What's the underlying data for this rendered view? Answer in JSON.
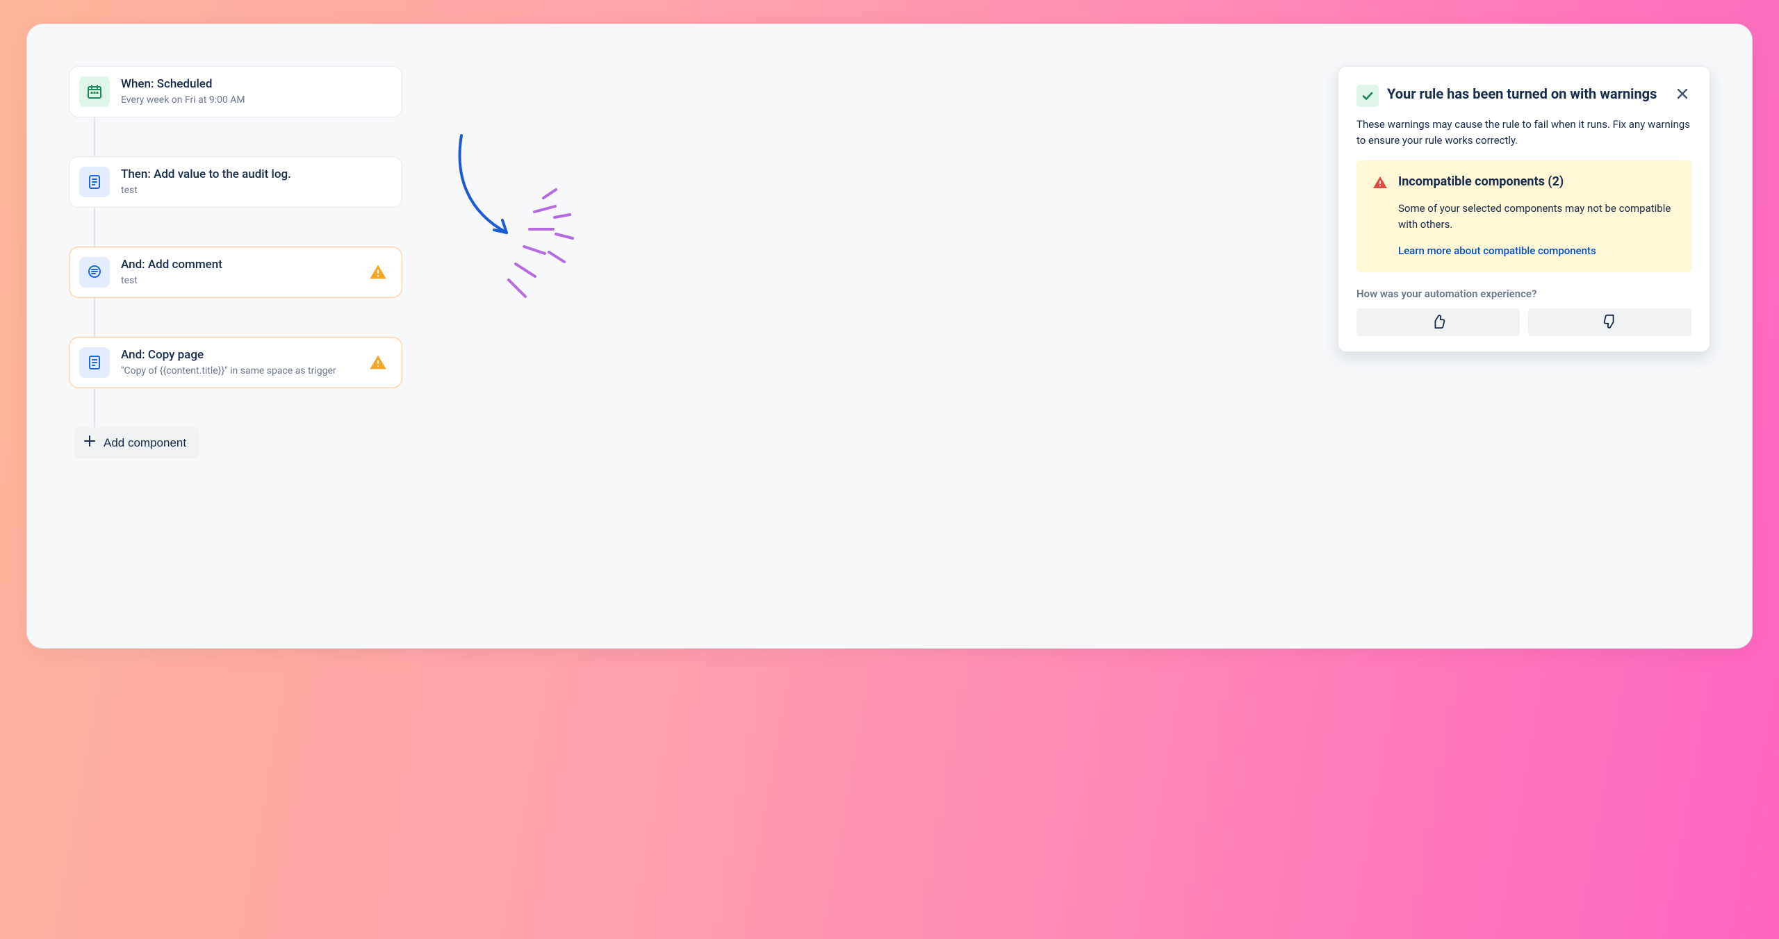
{
  "flow": {
    "nodes": [
      {
        "title": "When: Scheduled",
        "subtitle": "Every week on Fri at 9:00 AM",
        "icon": "calendar",
        "iconBg": "green",
        "warn": false
      },
      {
        "title": "Then: Add value to the audit log.",
        "subtitle": "test",
        "icon": "document",
        "iconBg": "blue",
        "warn": false
      },
      {
        "title": "And: Add comment",
        "subtitle": "test",
        "icon": "comment",
        "iconBg": "blue",
        "warn": true
      },
      {
        "title": "And: Copy page",
        "subtitle": "\"Copy of {{content.title}}\" in same space as trigger",
        "icon": "document",
        "iconBg": "blue",
        "warn": true
      }
    ],
    "add_label": "Add component"
  },
  "panel": {
    "title": "Your rule has been turned on with warnings",
    "desc": "These warnings may cause the rule to fail when it runs. Fix any warnings to ensure your rule works correctly.",
    "warning": {
      "title": "Incompatible components (2)",
      "body": "Some of your selected components may not be compatible with others.",
      "link": "Learn more about compatible components"
    },
    "feedback_label": "How was your automation experience?"
  }
}
